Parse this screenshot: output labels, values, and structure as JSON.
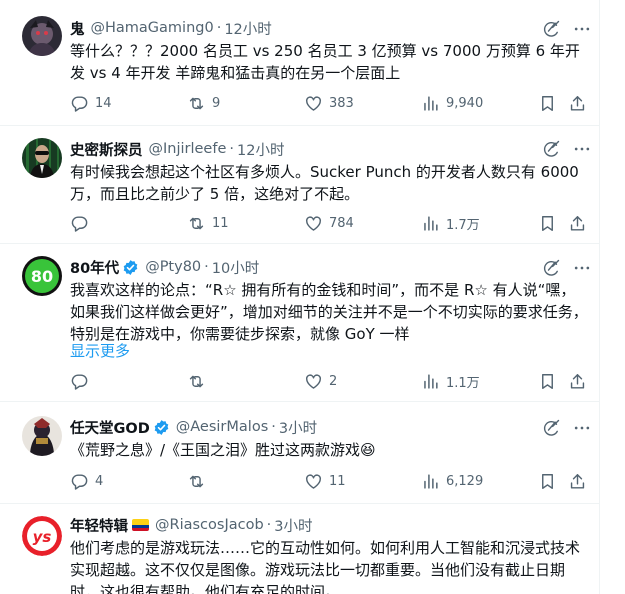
{
  "tweets": [
    {
      "name": "鬼",
      "handle": "@HamaGaming0",
      "time": "12小时",
      "verified": false,
      "flag": false,
      "text": "等什么？？？2000 名员工 vs 250 名员工 3 亿预算 vs 7000 万预算 6 年开发 vs 4 年开发 羊蹄鬼和猛击真的在另一个层面上",
      "show_more": "",
      "replies": "14",
      "retweets": "9",
      "likes": "383",
      "views": "9,940"
    },
    {
      "name": "史密斯探员",
      "handle": "@Injirleefe",
      "time": "12小时",
      "verified": false,
      "flag": false,
      "text": "有时候我会想起这个社区有多烦人。Sucker Punch 的开发者人数只有 6000 万，而且比之前少了 5 倍，这绝对了不起。",
      "show_more": "",
      "replies": "",
      "retweets": "11",
      "likes": "784",
      "views": "1.7万"
    },
    {
      "name": "80年代",
      "handle": "@Pty80",
      "time": "10小时",
      "verified": true,
      "flag": false,
      "text": "我喜欢这样的论点：“R☆ 拥有所有的金钱和时间”，而不是 R☆ 有人说“嘿，如果我们这样做会更好”，增加对细节的关注并不是一个不切实际的要求任务，特别是在游戏中，你需要徒步探索，就像 GoY 一样",
      "show_more": "显示更多",
      "replies": "",
      "retweets": "",
      "likes": "2",
      "views": "1.1万"
    },
    {
      "name": "任天堂GOD",
      "handle": "@AesirMalos",
      "time": "3小时",
      "verified": true,
      "flag": false,
      "text": "《荒野之息》/《王国之泪》胜过这两款游戏😆",
      "show_more": "",
      "replies": "4",
      "retweets": "",
      "likes": "11",
      "views": "6,129"
    },
    {
      "name": "年轻特辑",
      "handle": "@RiascosJacob",
      "time": "3小时",
      "verified": false,
      "flag": true,
      "text": "他们考虑的是游戏玩法……它的互动性如何。如何利用人工智能和沉浸式技术实现超越。这不仅仅是图像。游戏玩法比一切都重要。当他们没有截止日期时，这也很有帮助。他们有充足的时间。",
      "show_more": "",
      "replies": "",
      "retweets": "",
      "likes": "",
      "views": ""
    }
  ],
  "icons": {
    "reply": "reply-icon",
    "retweet": "retweet-icon",
    "like": "heart-icon",
    "views": "views-bar-chart-icon",
    "bookmark": "bookmark-icon",
    "share": "share-icon",
    "grok": "grok-icon",
    "more": "more-icon",
    "verified": "verified-badge-icon"
  },
  "colors": {
    "text": "#0f1419",
    "secondary": "#536471",
    "link": "#1d9bf0",
    "verified": "#1d9bf0",
    "divider": "#eff3f4"
  }
}
